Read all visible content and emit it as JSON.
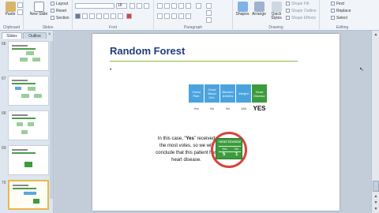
{
  "ribbon": {
    "clipboard": {
      "label": "Clipboard",
      "paste": "Paste"
    },
    "slides": {
      "label": "Slides",
      "new_slide": "New Slide",
      "layout": "Layout",
      "reset": "Reset",
      "section": "Section"
    },
    "font": {
      "label": "Font",
      "size": "18"
    },
    "paragraph": {
      "label": "Paragraph"
    },
    "drawing": {
      "label": "Drawing",
      "shapes": "Shapes",
      "arrange": "Arrange",
      "quick_styles": "Quick Styles",
      "shape_fill": "Shape Fill",
      "shape_outline": "Shape Outline",
      "shape_effects": "Shape Effects"
    },
    "editing": {
      "label": "Editing",
      "find": "Find",
      "replace": "Replace",
      "select": "Select"
    }
  },
  "left_pane": {
    "tab_slides": "Slides",
    "tab_outline": "Outline",
    "close": "×",
    "thumbnails": [
      {
        "num": "66"
      },
      {
        "num": "67"
      },
      {
        "num": "68"
      },
      {
        "num": "69"
      },
      {
        "num": "70"
      }
    ]
  },
  "slide": {
    "title": "Random Forest",
    "bullet": "•",
    "table": {
      "headers": [
        "Chest Pain",
        "Good Blood Circ.",
        "Blocked Arteries",
        "Weight",
        "Heart Disease"
      ],
      "values": [
        "Yes",
        "No",
        "No",
        "168",
        "YES"
      ]
    },
    "conclusion": {
      "pre": "In this case, “",
      "emph": "Yes",
      "post": "” received the most votes, so we will conclude that this patient has heart disease."
    },
    "vote_box": {
      "title": "Heart Disease",
      "col_yes": "Yes",
      "col_no": "No",
      "val_yes": "5",
      "val_no": "1"
    }
  },
  "colors": {
    "title": "#1f3d7a",
    "rule": "#8bbd3b",
    "header_blue": "#4aa3df",
    "header_green": "#3d9b3d",
    "circle": "#d9433d"
  }
}
